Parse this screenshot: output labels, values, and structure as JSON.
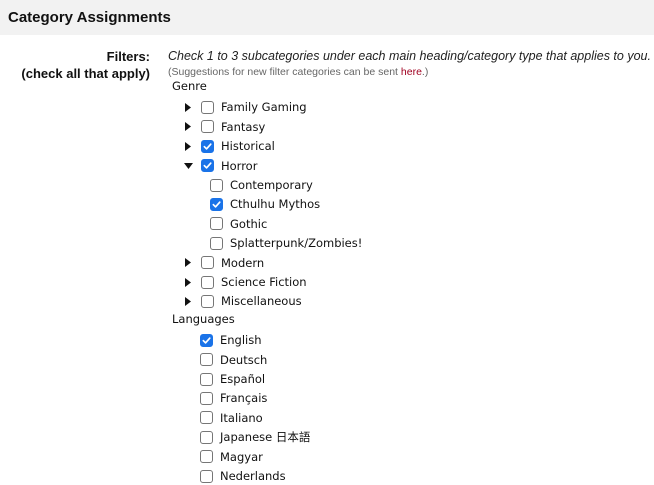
{
  "header": {
    "title": "Category Assignments"
  },
  "labels": {
    "filters": "Filters:",
    "check_all": "(check all that apply)"
  },
  "instructions": "Check 1 to 3 subcategories under each main heading/category type that applies to you.",
  "suggestion": {
    "prefix": "(Suggestions for new filter categories can be sent ",
    "link": "here",
    "suffix": ".)"
  },
  "genre": {
    "heading": "Genre",
    "items": [
      {
        "label": "Family Gaming",
        "checked": false,
        "expanded": false
      },
      {
        "label": "Fantasy",
        "checked": false,
        "expanded": false
      },
      {
        "label": "Historical",
        "checked": true,
        "expanded": false
      },
      {
        "label": "Horror",
        "checked": true,
        "expanded": true,
        "children": [
          {
            "label": "Contemporary",
            "checked": false
          },
          {
            "label": "Cthulhu Mythos",
            "checked": true
          },
          {
            "label": "Gothic",
            "checked": false
          },
          {
            "label": "Splatterpunk/Zombies!",
            "checked": false
          }
        ]
      },
      {
        "label": "Modern",
        "checked": false,
        "expanded": false
      },
      {
        "label": "Science Fiction",
        "checked": false,
        "expanded": false
      },
      {
        "label": "Miscellaneous",
        "checked": false,
        "expanded": false
      }
    ]
  },
  "languages": {
    "heading": "Languages",
    "items": [
      {
        "label": "English",
        "checked": true
      },
      {
        "label": "Deutsch",
        "checked": false
      },
      {
        "label": "Español",
        "checked": false
      },
      {
        "label": "Français",
        "checked": false
      },
      {
        "label": "Italiano",
        "checked": false
      },
      {
        "label": "Japanese 日本語",
        "checked": false
      },
      {
        "label": "Magyar",
        "checked": false
      },
      {
        "label": "Nederlands",
        "checked": false
      }
    ]
  },
  "colors": {
    "checkbox_checked": "#1a73e8",
    "link": "#a00020",
    "header_bg": "#f2f2f2"
  }
}
